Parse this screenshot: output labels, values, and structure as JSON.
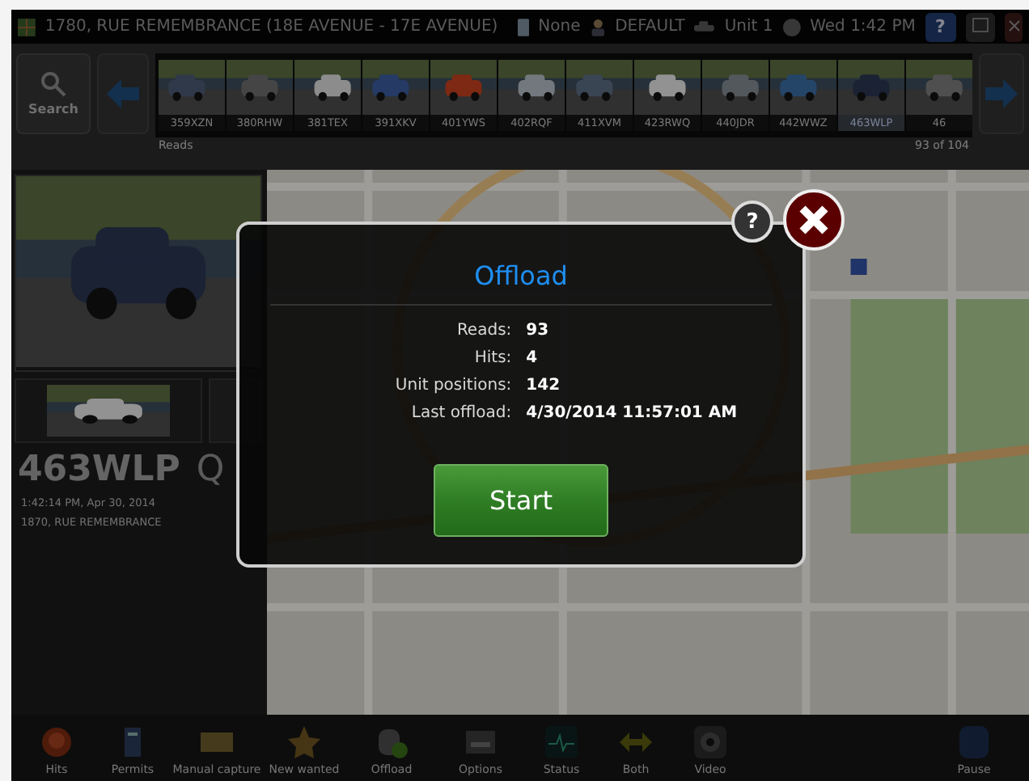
{
  "title_bar": {
    "location": "1780, RUE REMEMBRANCE  (18E AVENUE - 17E AVENUE)",
    "device": "None",
    "user": "DEFAULT",
    "unit": "Unit 1",
    "clock": "Wed 1:42 PM",
    "help": "?"
  },
  "reads_strip": {
    "search": "Search",
    "label": "Reads",
    "counter": "93 of 104",
    "thumbnails": [
      {
        "plate": "359XZN",
        "selected": false
      },
      {
        "plate": "380RHW",
        "selected": false
      },
      {
        "plate": "381TEX",
        "selected": false
      },
      {
        "plate": "391XKV",
        "selected": false
      },
      {
        "plate": "401YWS",
        "selected": false
      },
      {
        "plate": "402RQF",
        "selected": false
      },
      {
        "plate": "411XVM",
        "selected": false
      },
      {
        "plate": "423RWQ",
        "selected": false
      },
      {
        "plate": "440JDR",
        "selected": false
      },
      {
        "plate": "442WWZ",
        "selected": false
      },
      {
        "plate": "463WLP",
        "selected": true
      },
      {
        "plate": "46",
        "selected": false
      }
    ]
  },
  "read_detail": {
    "plate": "463WLP",
    "region": "Q",
    "time": "1:42:14 PM, Apr 30, 2014",
    "address": "1870, RUE REMEMBRANCE"
  },
  "toolbar": [
    {
      "label": "Hits",
      "kind": "hits"
    },
    {
      "label": "Permits",
      "kind": "permits"
    },
    {
      "label": "Manual capture",
      "kind": "capture"
    },
    {
      "label": "New wanted",
      "kind": "wanted"
    },
    {
      "label": "Offload",
      "kind": "offload"
    },
    {
      "label": "Options",
      "kind": "options"
    },
    {
      "label": "Status",
      "kind": "status"
    },
    {
      "label": "Both",
      "kind": "both"
    },
    {
      "label": "Video",
      "kind": "video"
    },
    {
      "label": "Pause",
      "kind": "pause"
    }
  ],
  "dialog": {
    "title": "Offload",
    "help": "?",
    "fields": [
      {
        "label": "Reads:",
        "value": "93"
      },
      {
        "label": "Hits:",
        "value": "4"
      },
      {
        "label": "Unit positions:",
        "value": "142"
      },
      {
        "label": "Last offload:",
        "value": "4/30/2014 11:57:01 AM"
      }
    ],
    "button": "Start"
  }
}
